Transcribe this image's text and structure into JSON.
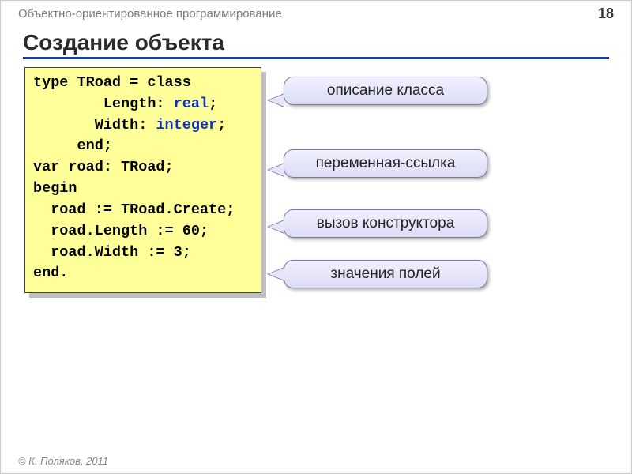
{
  "header": {
    "course": "Объектно-ориентированное программирование",
    "page_number": "18"
  },
  "title": "Создание объекта",
  "code": {
    "l1a": "type",
    "l1b": " TRoad = ",
    "l1c": "class",
    "l2a": "        Length: ",
    "l2b": "real",
    "l2c": ";",
    "l3a": "       Width: ",
    "l3b": "integer",
    "l3c": ";",
    "l4": "     end;",
    "l5a": "var",
    "l5b": " road: TRoad;",
    "l6": "begin",
    "l7": "  road := TRoad.Create;",
    "l8": "  road.Length := 60;",
    "l9": "  road.Width := 3;",
    "l10": "end."
  },
  "callouts": {
    "c1": "описание класса",
    "c2": "переменная-ссылка",
    "c3": "вызов конструктора",
    "c4": "значения полей"
  },
  "footer": "© К. Поляков, 2011"
}
